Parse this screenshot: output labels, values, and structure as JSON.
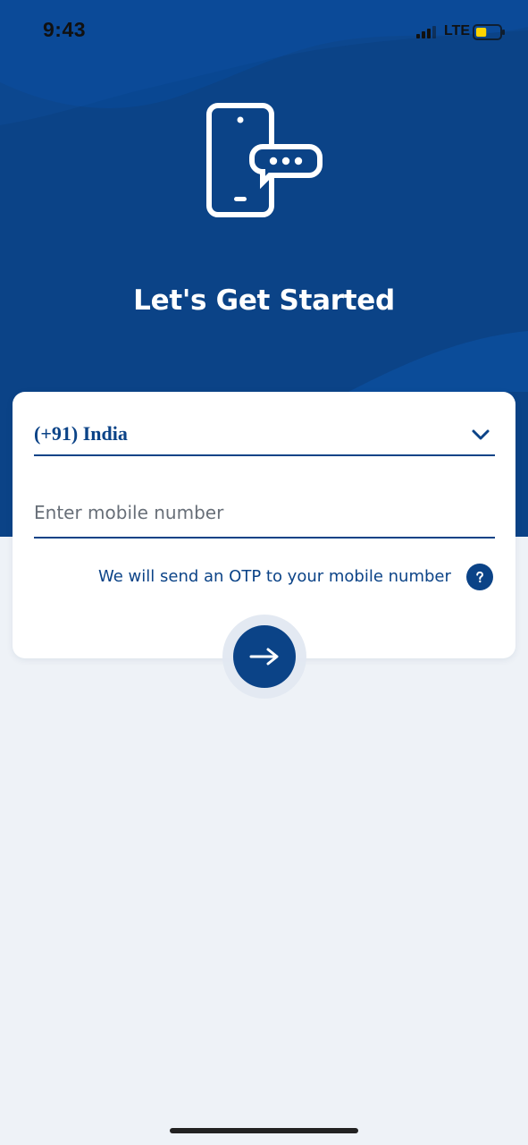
{
  "status_bar": {
    "time": "9:43",
    "network": "LTE",
    "battery_level": 0.45,
    "icons": [
      "signal-icon",
      "battery-icon"
    ]
  },
  "hero": {
    "icon": "phone-chat-icon",
    "title": "Let's Get Started"
  },
  "form": {
    "country": {
      "selected": "(+91) India",
      "icon": "chevron-down-icon"
    },
    "mobile": {
      "placeholder": "Enter mobile number",
      "value": ""
    },
    "otp_note": "We will send an OTP to your mobile number",
    "help_icon": "question-mark-icon",
    "submit_icon": "arrow-right-icon"
  },
  "colors": {
    "primary": "#0b4387",
    "background": "#eef2f7",
    "card": "#ffffff",
    "text_muted": "#686f78"
  }
}
